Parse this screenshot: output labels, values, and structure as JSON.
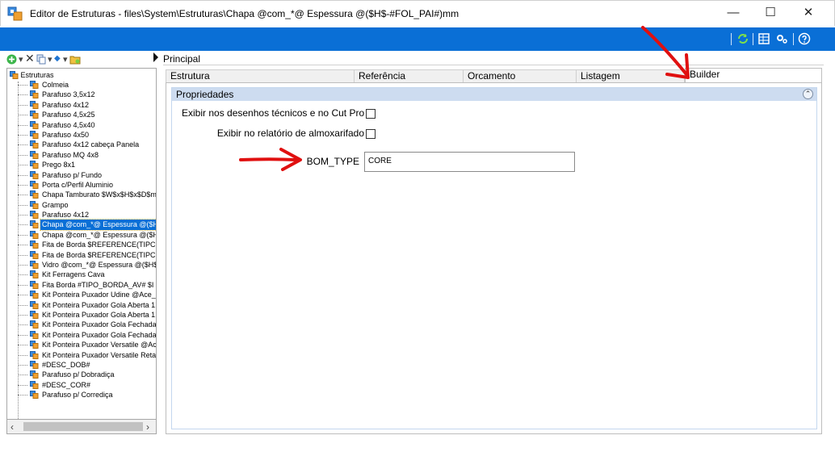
{
  "window": {
    "title": "Editor de Estruturas - files\\System\\Estruturas\\Chapa @com_*@ Espessura @($H$-#FOL_PAI#)mm",
    "minimize": "—",
    "maximize": "☐",
    "close": "✕"
  },
  "colors": {
    "accent": "#0a6fd6",
    "header_band": "#cddcf0",
    "arrow": "#e01010"
  },
  "toolbar_icons": [
    "refresh-icon",
    "grid-view-icon",
    "settings-icon",
    "help-icon"
  ],
  "tree": {
    "root": "Estruturas",
    "items": [
      {
        "label": "Colmeia"
      },
      {
        "label": "Parafuso 3,5x12"
      },
      {
        "label": "Parafuso 4x12"
      },
      {
        "label": "Parafuso 4,5x25"
      },
      {
        "label": "Parafuso 4,5x40"
      },
      {
        "label": "Parafuso 4x50"
      },
      {
        "label": "Parafuso 4x12  cabeça Panela"
      },
      {
        "label": "Parafuso MQ 4x8"
      },
      {
        "label": "Prego 8x1"
      },
      {
        "label": "Parafuso p/ Fundo"
      },
      {
        "label": "Porta c/Perfil Aluminio"
      },
      {
        "label": "Chapa Tamburato $W$x$H$x$D$m"
      },
      {
        "label": "Grampo"
      },
      {
        "label": "Parafuso 4x12"
      },
      {
        "label": "Chapa @com_*@ Espessura @($H",
        "selected": true
      },
      {
        "label": "Chapa @com_*@ Espessura @($H"
      },
      {
        "label": "Fita de Borda $REFERENCE(TIPC"
      },
      {
        "label": "Fita de Borda $REFERENCE(TIPC"
      },
      {
        "label": "Vidro @com_*@ Espessura @($H$"
      },
      {
        "label": "Kit Ferragens Cava"
      },
      {
        "label": "Fita Borda #TIPO_BORDA_AV# $I"
      },
      {
        "label": "Kit Ponteira Puxador Udine @Ace_I"
      },
      {
        "label": "Kit Ponteira Puxador Gola Aberta 1!"
      },
      {
        "label": "Kit Ponteira Puxador Gola Aberta 1!"
      },
      {
        "label": "Kit Ponteira Puxador Gola Fechada"
      },
      {
        "label": "Kit Ponteira Puxador Gola Fechada"
      },
      {
        "label": "Kit Ponteira Puxador Versatile @Ac"
      },
      {
        "label": "Kit Ponteira Puxador Versatile Reta"
      },
      {
        "label": "#DESC_DOB#"
      },
      {
        "label": "Parafuso p/ Dobradiça"
      },
      {
        "label": "#DESC_COR#"
      },
      {
        "label": "Parafuso p/ Corrediça"
      }
    ]
  },
  "main": {
    "header": "Principal",
    "tabs": [
      {
        "label": "Estrutura"
      },
      {
        "label": "Referência"
      },
      {
        "label": "Orcamento"
      },
      {
        "label": "Listagem"
      },
      {
        "label": "Builder",
        "active": true
      }
    ],
    "section_title": "Propriedades",
    "properties": {
      "show_in_drawings_label": "Exibir nos desenhos técnicos e no Cut Pro",
      "show_in_drawings_checked": false,
      "show_in_warehouse_label": "Exibir no relatório de almoxarifado",
      "show_in_warehouse_checked": false,
      "bom_type_label": "BOM_TYPE",
      "bom_type_value": "CORE"
    }
  }
}
